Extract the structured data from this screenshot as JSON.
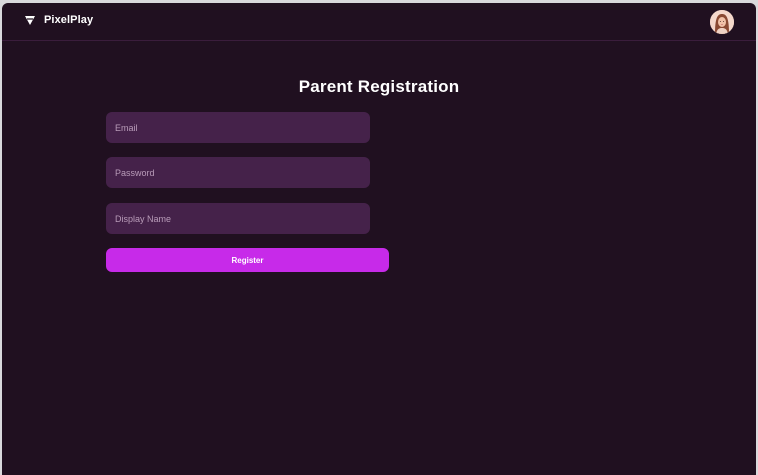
{
  "app": {
    "name": "PixelPlay",
    "logo_icon": "triangle-down-icon",
    "avatar_icon": "user-avatar"
  },
  "form": {
    "title": "Parent Registration",
    "email_placeholder": "Email",
    "password_placeholder": "Password",
    "display_name_placeholder": "Display Name",
    "submit_label": "Register"
  },
  "colors": {
    "background": "#201020",
    "input_background": "#45224a",
    "accent": "#c72ae9",
    "placeholder": "#b99cb9"
  }
}
